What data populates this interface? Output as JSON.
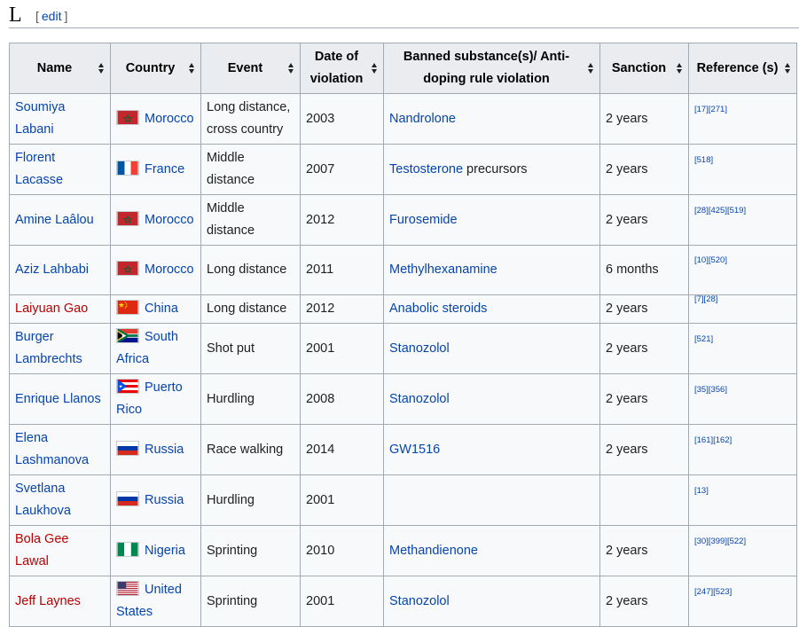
{
  "section": {
    "letter": "L",
    "edit_open": "[",
    "edit_label": "edit",
    "edit_close": "]"
  },
  "columns": [
    "Name",
    "Country",
    "Event",
    "Date of violation",
    "Banned substance(s)/ Anti-doping rule violation",
    "Sanction",
    "Reference (s)"
  ],
  "colors": {
    "link": "#0645ad",
    "redlink": "#ba0000",
    "header_bg": "#eaecf0",
    "cell_bg": "#f8f9fa",
    "border": "#a2a9b1"
  },
  "rows": [
    {
      "name": "Soumiya Labani",
      "name_red": false,
      "flag": "morocco-flag-icon",
      "country": "Morocco",
      "event": "Long distance, cross country",
      "date": "2003",
      "substance": "Nandrolone",
      "substance_extra": "",
      "sanction": "2 years",
      "refs": "[17][271]"
    },
    {
      "name": "Florent Lacasse",
      "name_red": false,
      "flag": "france-flag-icon",
      "country": "France",
      "event": "Middle distance",
      "date": "2007",
      "substance": "Testosterone",
      "substance_extra": " precursors",
      "sanction": "2 years",
      "refs": "[518]"
    },
    {
      "name": "Amine Laâlou",
      "name_red": false,
      "flag": "morocco-flag-icon",
      "country": "Morocco",
      "event": "Middle distance",
      "date": "2012",
      "substance": "Furosemide",
      "substance_extra": "",
      "sanction": "2 years",
      "refs": "[28][425][519]"
    },
    {
      "name": "Aziz Lahbabi",
      "name_red": false,
      "flag": "morocco-flag-icon",
      "country": "Morocco",
      "event": "Long distance",
      "date": "2011",
      "substance": "Methylhexanamine",
      "substance_extra": "",
      "sanction": "6 months",
      "refs": "[10][520]"
    },
    {
      "name": "Laiyuan Gao",
      "name_red": true,
      "flag": "china-flag-icon",
      "country": "China",
      "event": "Long distance",
      "date": "2012",
      "substance": "Anabolic steroids",
      "substance_extra": "",
      "sanction": "2 years",
      "refs": "[7][28]"
    },
    {
      "name": "Burger Lambrechts",
      "name_red": false,
      "flag": "south-africa-flag-icon",
      "country": "South Africa",
      "event": "Shot put",
      "date": "2001",
      "substance": "Stanozolol",
      "substance_extra": "",
      "sanction": "2 years",
      "refs": "[521]"
    },
    {
      "name": "Enrique Llanos",
      "name_red": false,
      "flag": "puerto-rico-flag-icon",
      "country": "Puerto Rico",
      "event": "Hurdling",
      "date": "2008",
      "substance": "Stanozolol",
      "substance_extra": "",
      "sanction": "2 years",
      "refs": "[35][356]"
    },
    {
      "name": "Elena Lashmanova",
      "name_red": false,
      "flag": "russia-flag-icon",
      "country": "Russia",
      "event": "Race walking",
      "date": "2014",
      "substance": "GW1516",
      "substance_extra": "",
      "sanction": "2 years",
      "refs": "[161][162]"
    },
    {
      "name": "Svetlana Laukhova",
      "name_red": false,
      "flag": "russia-flag-icon",
      "country": "Russia",
      "event": "Hurdling",
      "date": "2001",
      "substance": "",
      "substance_extra": "",
      "sanction": "",
      "refs": "[13]"
    },
    {
      "name": "Bola Gee Lawal",
      "name_red": true,
      "flag": "nigeria-flag-icon",
      "country": "Nigeria",
      "event": "Sprinting",
      "date": "2010",
      "substance": "Methandienone",
      "substance_extra": "",
      "sanction": "2 years",
      "refs": "[30][399][522]"
    },
    {
      "name": "Jeff Laynes",
      "name_red": true,
      "flag": "united-states-flag-icon",
      "country": "United States",
      "event": "Sprinting",
      "date": "2001",
      "substance": "Stanozolol",
      "substance_extra": "",
      "sanction": "2 years",
      "refs": "[247][523]"
    }
  ]
}
